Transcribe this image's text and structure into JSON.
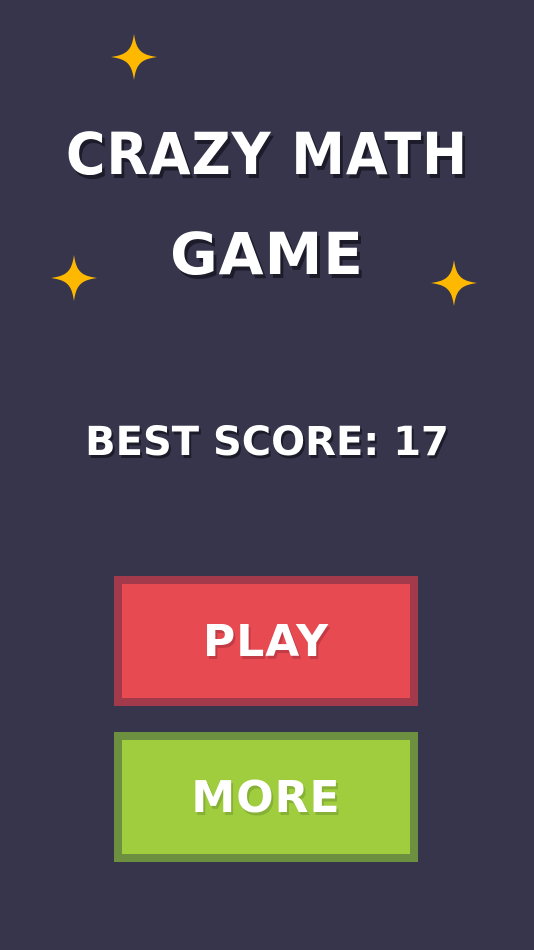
{
  "title": {
    "line1": "CRAZY MATH",
    "line2": "GAME"
  },
  "best_score": {
    "text": "BEST SCORE: 17",
    "value": 17
  },
  "buttons": {
    "play_label": "PLAY",
    "more_label": "MORE"
  },
  "colors": {
    "background": "#36354b",
    "play": "#e84a52",
    "play_border": "#a33a4b",
    "more": "#9fcd3e",
    "more_border": "#6c9040",
    "sparkle": "#ffb800"
  },
  "icons": [
    "sparkle-icon",
    "sparkle-icon",
    "sparkle-icon"
  ]
}
